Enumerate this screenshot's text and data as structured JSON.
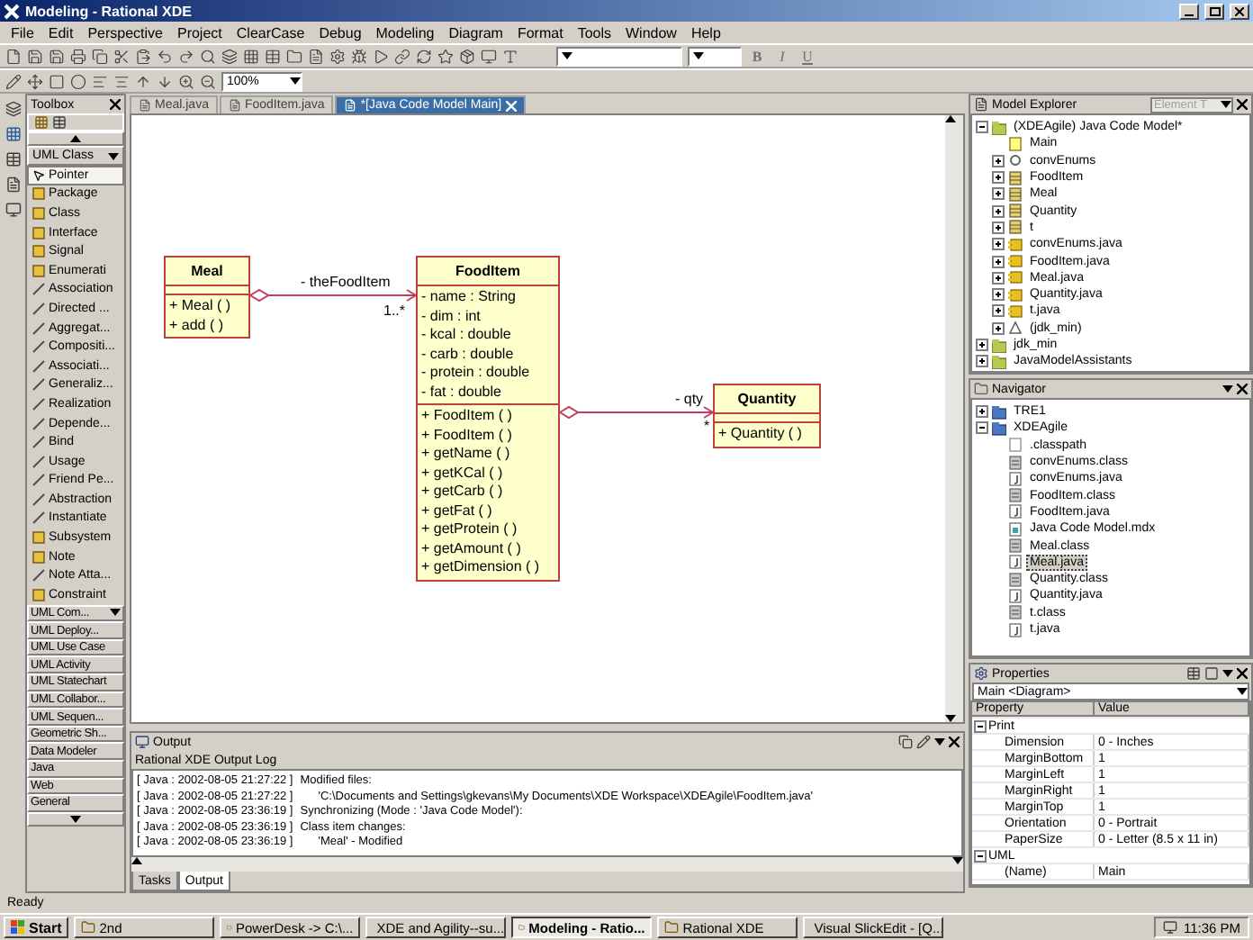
{
  "window": {
    "title": "Modeling - Rational XDE"
  },
  "menu": [
    "File",
    "Edit",
    "Perspective",
    "Project",
    "ClearCase",
    "Debug",
    "Modeling",
    "Diagram",
    "Format",
    "Tools",
    "Window",
    "Help"
  ],
  "toolbar": {
    "zoom": "100%",
    "format_buttons": [
      {
        "label": "B",
        "kind": "bold"
      },
      {
        "label": "I",
        "kind": "italic"
      },
      {
        "label": "U",
        "kind": "underline"
      }
    ]
  },
  "toolbox": {
    "title": "Toolbox",
    "section": "UML Class",
    "items": [
      {
        "label": "Pointer",
        "kind": "pointer",
        "selected": true
      },
      {
        "label": "Package",
        "kind": "element",
        "selected": false
      },
      {
        "label": "Class",
        "kind": "element",
        "selected": false
      },
      {
        "label": "Interface",
        "kind": "element",
        "selected": false
      },
      {
        "label": "Signal",
        "kind": "element",
        "selected": false
      },
      {
        "label": "Enumerati",
        "kind": "element",
        "selected": false
      },
      {
        "label": "Association",
        "kind": "relationship",
        "selected": false
      },
      {
        "label": "Directed ...",
        "kind": "relationship",
        "selected": false
      },
      {
        "label": "Aggregat...",
        "kind": "relationship",
        "selected": false
      },
      {
        "label": "Compositi...",
        "kind": "relationship",
        "selected": false
      },
      {
        "label": "Associati...",
        "kind": "relationship",
        "selected": false
      },
      {
        "label": "Generaliz...",
        "kind": "relationship",
        "selected": false
      },
      {
        "label": "Realization",
        "kind": "relationship",
        "selected": false
      },
      {
        "label": "Depende...",
        "kind": "relationship",
        "selected": false
      },
      {
        "label": "Bind",
        "kind": "relationship",
        "selected": false
      },
      {
        "label": "Usage",
        "kind": "relationship",
        "selected": false
      },
      {
        "label": "Friend Pe...",
        "kind": "relationship",
        "selected": false
      },
      {
        "label": "Abstraction",
        "kind": "relationship",
        "selected": false
      },
      {
        "label": "Instantiate",
        "kind": "relationship",
        "selected": false
      },
      {
        "label": "Subsystem",
        "kind": "element",
        "selected": false
      },
      {
        "label": "Note",
        "kind": "element",
        "selected": false
      },
      {
        "label": "Note Atta...",
        "kind": "relationship",
        "selected": false
      },
      {
        "label": "Constraint",
        "kind": "element",
        "selected": false
      }
    ],
    "drawers": [
      "UML Com...",
      "UML Deploy...",
      "UML Use Case",
      "UML Activity",
      "UML Statechart",
      "UML Collabor...",
      "UML Sequen...",
      "Geometric Sh...",
      "Data Modeler",
      "Java",
      "Web",
      "General"
    ]
  },
  "editor_tabs": [
    {
      "label": "Meal.java",
      "selected": false
    },
    {
      "label": "FoodItem.java",
      "selected": false
    },
    {
      "label": "*[Java Code Model Main]",
      "selected": true
    }
  ],
  "diagram": {
    "classes": [
      {
        "name": "Meal",
        "operations": [
          "+ Meal ( )",
          "+ add ( )"
        ]
      },
      {
        "name": "FoodItem",
        "attributes": [
          "- name : String",
          "- dim : int",
          "- kcal : double",
          "- carb : double",
          "- protein : double",
          "- fat : double"
        ],
        "operations": [
          "+ FoodItem ( )",
          "+ FoodItem ( )",
          "+ getName ( )",
          "+ getKCal ( )",
          "+ getCarb ( )",
          "+ getFat ( )",
          "+ getProtein ( )",
          "+ getAmount ( )",
          "+ getDimension ( )"
        ]
      },
      {
        "name": "Quantity",
        "operations": [
          "+ Quantity ( )"
        ]
      }
    ],
    "associations": [
      {
        "role": "- theFoodItem",
        "multiplicity": "1..*"
      },
      {
        "role": "- qty",
        "multiplicity": "*"
      }
    ]
  },
  "output": {
    "title": "Output",
    "source": "Rational XDE Output Log",
    "lines": [
      {
        "timestamp": "[ Java : 2002-08-05 21:27:22 ]",
        "message": "Modified files:",
        "kind": "message"
      },
      {
        "timestamp": "[ Java : 2002-08-05 21:27:22 ]",
        "message": "'C:\\Documents and Settings\\gkevans\\My Documents\\XDE Workspace\\XDEAgile\\FoodItem.java'",
        "kind": "detail"
      },
      {
        "timestamp": "[ Java : 2002-08-05 23:36:19 ]",
        "message": "Synchronizing (Mode : 'Java Code Model'):",
        "kind": "message"
      },
      {
        "timestamp": "[ Java : 2002-08-05 23:36:19 ]",
        "message": "Class item changes:",
        "kind": "message"
      },
      {
        "timestamp": "[ Java : 2002-08-05 23:36:19 ]",
        "message": "'Meal' - Modified",
        "kind": "detail"
      }
    ],
    "tabs": [
      {
        "label": "Tasks",
        "selected": false
      },
      {
        "label": "Output",
        "selected": true
      }
    ]
  },
  "model_explorer": {
    "title": "Model Explorer",
    "filter": "Element T",
    "tree": [
      {
        "label": "(XDEAgile) Java Code Model*",
        "kind": "model",
        "expanded": true,
        "children": [
          {
            "label": "Main",
            "kind": "diagram"
          },
          {
            "label": "convEnums",
            "kind": "enum",
            "expanded": false
          },
          {
            "label": "FoodItem",
            "kind": "class",
            "expanded": false
          },
          {
            "label": "Meal",
            "kind": "class",
            "expanded": false
          },
          {
            "label": "Quantity",
            "kind": "class",
            "expanded": false
          },
          {
            "label": "t",
            "kind": "class",
            "expanded": false
          },
          {
            "label": "convEnums.java",
            "kind": "component",
            "expanded": false
          },
          {
            "label": "FoodItem.java",
            "kind": "component",
            "expanded": false
          },
          {
            "label": "Meal.java",
            "kind": "component",
            "expanded": false
          },
          {
            "label": "Quantity.java",
            "kind": "component",
            "expanded": false
          },
          {
            "label": "t.java",
            "kind": "component",
            "expanded": false
          },
          {
            "label": "(jdk_min)",
            "kind": "reference",
            "expanded": false
          }
        ]
      },
      {
        "label": "jdk_min",
        "kind": "model",
        "expanded": false
      },
      {
        "label": "JavaModelAssistants",
        "kind": "model",
        "expanded": false
      }
    ]
  },
  "navigator": {
    "title": "Navigator",
    "tree": [
      {
        "label": "TRE1",
        "kind": "project",
        "expanded": false,
        "selected": false
      },
      {
        "label": "XDEAgile",
        "kind": "project",
        "expanded": true,
        "selected": false,
        "children": [
          {
            "label": ".classpath",
            "kind": "file",
            "selected": false
          },
          {
            "label": "convEnums.class",
            "kind": "classfile",
            "selected": false
          },
          {
            "label": "convEnums.java",
            "kind": "javafile",
            "selected": false
          },
          {
            "label": "FoodItem.class",
            "kind": "classfile",
            "selected": false
          },
          {
            "label": "FoodItem.java",
            "kind": "javafile",
            "selected": false
          },
          {
            "label": "Java Code Model.mdx",
            "kind": "modelfile",
            "selected": false
          },
          {
            "label": "Meal.class",
            "kind": "classfile",
            "selected": false
          },
          {
            "label": "Meal.java",
            "kind": "javafile",
            "selected": true
          },
          {
            "label": "Quantity.class",
            "kind": "classfile",
            "selected": false
          },
          {
            "label": "Quantity.java",
            "kind": "javafile",
            "selected": false
          },
          {
            "label": "t.class",
            "kind": "classfile",
            "selected": false
          },
          {
            "label": "t.java",
            "kind": "javafile",
            "selected": false
          }
        ]
      }
    ]
  },
  "properties": {
    "title": "Properties",
    "object": "Main <Diagram>",
    "columns": [
      "Property",
      "Value"
    ],
    "groups": [
      {
        "name": "Print",
        "expanded": true,
        "rows": [
          {
            "property": "Dimension",
            "value": "0 - Inches"
          },
          {
            "property": "MarginBottom",
            "value": "1"
          },
          {
            "property": "MarginLeft",
            "value": "1"
          },
          {
            "property": "MarginRight",
            "value": "1"
          },
          {
            "property": "MarginTop",
            "value": "1"
          },
          {
            "property": "Orientation",
            "value": "0 - Portrait"
          },
          {
            "property": "PaperSize",
            "value": "0 - Letter (8.5 x 11 in)"
          }
        ]
      },
      {
        "name": "UML",
        "expanded": true,
        "rows": [
          {
            "property": "(Name)",
            "value": "Main"
          }
        ]
      }
    ]
  },
  "status_bar": "Ready",
  "taskbar": {
    "start": "Start",
    "tasks": [
      {
        "label": "2nd",
        "selected": false
      },
      {
        "label": "PowerDesk -> C:\\...",
        "selected": false
      },
      {
        "label": "XDE and Agility--su...",
        "selected": false
      },
      {
        "label": "Modeling - Ratio...",
        "selected": true
      },
      {
        "label": "Rational XDE",
        "selected": false
      },
      {
        "label": "Visual SlickEdit - [Q...",
        "selected": false
      }
    ],
    "clock": "11:36 PM"
  }
}
